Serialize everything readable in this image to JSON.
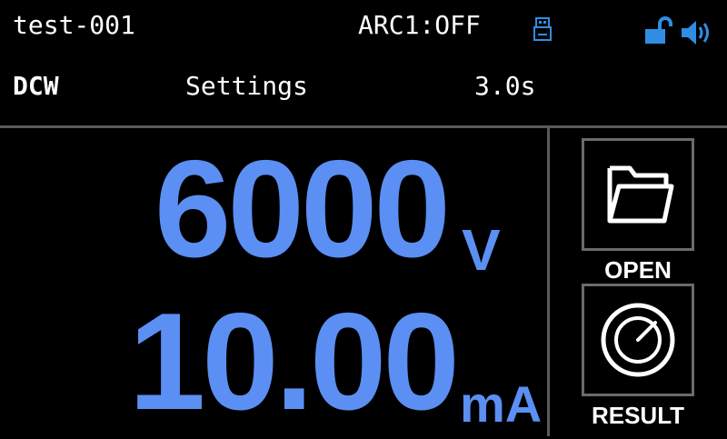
{
  "status_bar": {
    "file_name": "test-001",
    "arc_status": "ARC1:OFF",
    "icons": [
      "usb-icon",
      "unlock-icon",
      "speaker-icon"
    ],
    "accent_color": "#2f8de4"
  },
  "info_bar": {
    "mode": "DCW",
    "settings_label": "Settings",
    "time": "3.0s"
  },
  "readings": {
    "voltage": {
      "value": "6000",
      "unit": "V"
    },
    "current": {
      "value": "10.00",
      "unit": "mA"
    },
    "color": "#5b8ff3"
  },
  "buttons": {
    "open": {
      "label": "OPEN",
      "icon": "folder-icon"
    },
    "result": {
      "label": "RESULT",
      "icon": "gauge-icon"
    }
  }
}
